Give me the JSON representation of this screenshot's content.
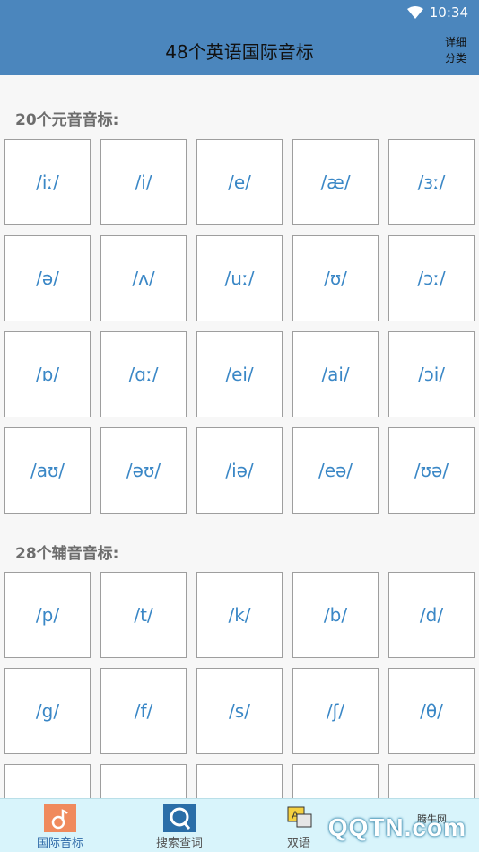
{
  "status": {
    "time": "10:34"
  },
  "header": {
    "title": "48个英语国际音标",
    "detail_label": "详细分类"
  },
  "vowels": {
    "title": "20个元音音标:",
    "items": [
      "/iː/",
      "/i/",
      "/e/",
      "/æ/",
      "/ɜː/",
      "/ə/",
      "/ʌ/",
      "/uː/",
      "/ʊ/",
      "/ɔː/",
      "/ɒ/",
      "/ɑː/",
      "/ei/",
      "/ai/",
      "/ɔi/",
      "/aʊ/",
      "/əʊ/",
      "/iə/",
      "/eə/",
      "/ʊə/"
    ]
  },
  "consonants": {
    "title": "28个辅音音标:",
    "items": [
      "/p/",
      "/t/",
      "/k/",
      "/b/",
      "/d/",
      "/g/",
      "/f/",
      "/s/",
      "/ʃ/",
      "/θ/",
      "",
      "",
      "",
      "",
      ""
    ]
  },
  "nav": {
    "items": [
      {
        "label": "国际音标",
        "icon": "music-note-icon"
      },
      {
        "label": "搜索查词",
        "icon": "search-icon"
      },
      {
        "label": "双语",
        "icon": "bilingual-icon"
      }
    ]
  },
  "watermark": {
    "text": "QQTN.com",
    "small": "腾牛网"
  },
  "colors": {
    "appbar": "#4b86bd",
    "phonetic": "#3a87c6",
    "nav_bg": "#d8f4fb",
    "active_tab_icon": "#f08a5d"
  }
}
